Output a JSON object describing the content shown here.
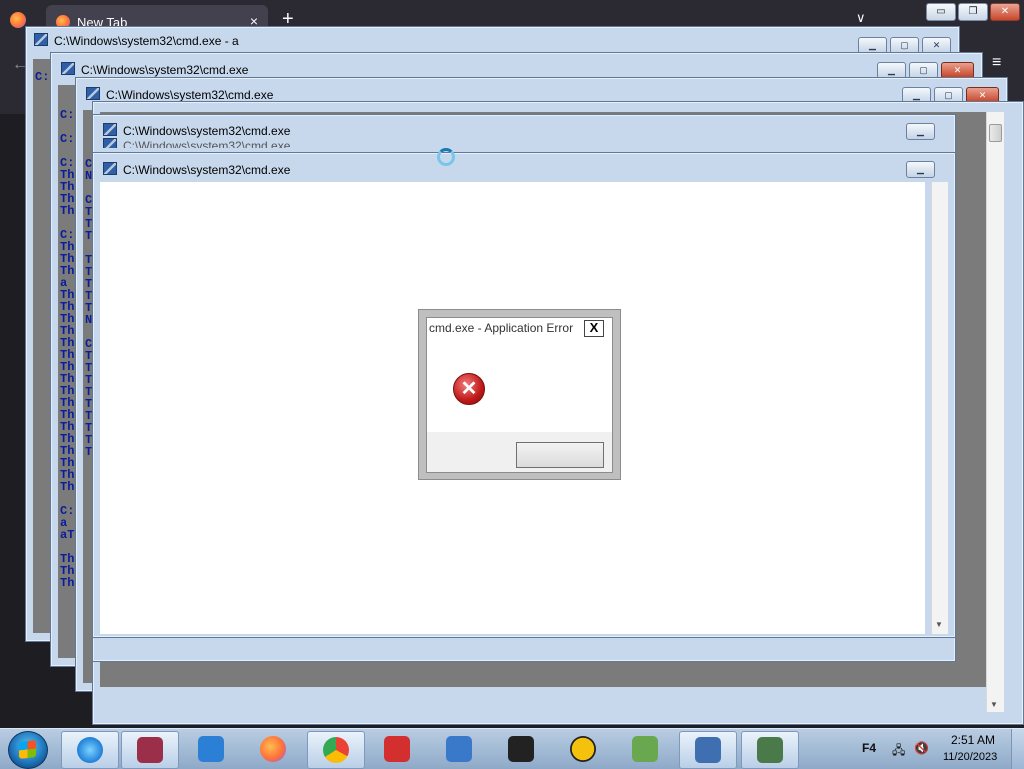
{
  "browser": {
    "tab_label": "New Tab",
    "tab_close": "×",
    "new_tab": "+",
    "list_tabs": "∨",
    "back": "←",
    "menu": "≡",
    "window_controls": [
      "▭",
      "❐",
      "✕"
    ]
  },
  "cmd_windows": [
    {
      "title": "C:\\Windows\\system32\\cmd.exe - a",
      "text": "\nC:"
    },
    {
      "title": "C:\\Windows\\system32\\cmd.exe",
      "text": "\n\nC:\n\nC:\n\nC:\nTh\nTh\nTh\nTh\n\nC:\nTh\nTh\nTh\na\nTh\nTh\nTh\nTh\nTh\nTh\nTh\nTh\nTh\nTh\nTh\nTh\nTh\nTh\nTh\nTh\nTh\n\nC:\na\naT\n\nTh\nTh\nTh"
    },
    {
      "title": "C:\\Windows\\system32\\cmd.exe",
      "text": "\n\n\n\nC\nN\n\nC\nT\nT\nT\n\nT\nT\nT\nT\nT\nN\n\nC\nT\nT\nT\nT\nT\nT\nT\nT\nT"
    },
    {
      "title": "C:\\Windows\\system32\\cmd.exe"
    },
    {
      "title": "C:\\Windows\\system32\\cmd.exe"
    },
    {
      "title": "C:\\Windows\\system32\\cmd.exe"
    }
  ],
  "cmd_buttons": {
    "minimize": "▁",
    "maximize": "▢",
    "close": "✕"
  },
  "dialog": {
    "title": "cmd.exe - Application Error",
    "close": "X",
    "error_icon": "✕",
    "ok_label": ""
  },
  "taskbar": {
    "items": [
      {
        "name": "internet-explorer",
        "icon": "ie-icon",
        "color": "#2e8ad8"
      },
      {
        "name": "winrar",
        "icon": "archive-icon",
        "color": "#9b2f4a"
      },
      {
        "name": "itunes",
        "icon": "music-note-icon",
        "color": "#2b7fd4"
      },
      {
        "name": "firefox",
        "icon": "firefox-icon",
        "color": "#ff7139"
      },
      {
        "name": "chrome",
        "icon": "chrome-icon",
        "color": "#34a853"
      },
      {
        "name": "java",
        "icon": "java-icon",
        "color": "#d32f2f"
      },
      {
        "name": "tool",
        "icon": "tool-icon",
        "color": "#3a78c9"
      },
      {
        "name": "paint",
        "icon": "paintbrush-icon",
        "color": "#222222"
      },
      {
        "name": "app-triangle",
        "icon": "triangle-icon",
        "color": "#f4c20d"
      },
      {
        "name": "notepad-plus",
        "icon": "notepad-icon",
        "color": "#6aa84f"
      },
      {
        "name": "cmd-group",
        "icon": "cmd-icon",
        "color": "#3f6fb0"
      },
      {
        "name": "window-app",
        "icon": "window-icon",
        "color": "#4a7a4a"
      }
    ],
    "tray_lang": "F4",
    "clock_time": "2:51 AM",
    "clock_date": "11/20/2023"
  }
}
